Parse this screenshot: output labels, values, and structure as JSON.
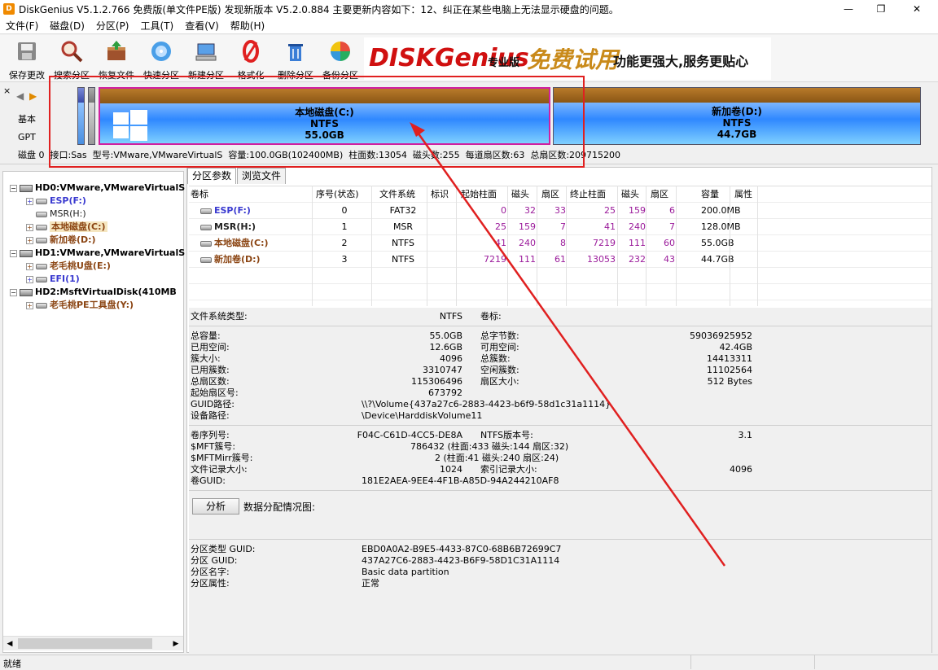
{
  "window": {
    "title": "DiskGenius V5.1.2.766 免费版(单文件PE版)   发现新版本 V5.2.0.884 主要更新内容如下：12、纠正在某些电脑上无法显示硬盘的问题。",
    "app_icon_text": "D",
    "minimize": "—",
    "maximize": "❐",
    "close": "✕"
  },
  "menu": [
    "文件(F)",
    "磁盘(D)",
    "分区(P)",
    "工具(T)",
    "查看(V)",
    "帮助(H)"
  ],
  "toolbar": [
    {
      "label": "保存更改",
      "icon": "save-icon",
      "color": "#777777"
    },
    {
      "label": "搜索分区",
      "icon": "magnifier-icon",
      "color": "#c0392b"
    },
    {
      "label": "恢复文件",
      "icon": "recover-box-icon",
      "color": "#a0522d"
    },
    {
      "label": "快速分区",
      "icon": "disc-icon",
      "color": "#2a7fd4"
    },
    {
      "label": "新建分区",
      "icon": "new-partition-icon",
      "color": "#4a90d9"
    },
    {
      "label": "格式化",
      "icon": "format-icon",
      "color": "#e02020"
    },
    {
      "label": "删除分区",
      "icon": "trash-icon",
      "color": "#2b6cc4"
    },
    {
      "label": "备份分区",
      "icon": "backup-pie-icon",
      "color": "#27ae60"
    }
  ],
  "banner": {
    "logo": "DISKGenius",
    "edition": "专业版",
    "slogan1": "免费试用",
    "slogan2": "功能更强大,服务更贴心"
  },
  "diskmap": {
    "left_labels": [
      "基本",
      "GPT"
    ],
    "nav_left": "◀",
    "nav_right": "▶",
    "close_x": "×",
    "partitions": [
      {
        "name": "本地磁盘(C:)",
        "fs": "NTFS",
        "size": "55.0GB"
      },
      {
        "name": "新加卷(D:)",
        "fs": "NTFS",
        "size": "44.7GB"
      }
    ],
    "info": "磁盘 0  接口:Sas  型号:VMware,VMwareVirtualS  容量:100.0GB(102400MB)  柱面数:13054  磁头数:255  每道扇区数:63  总扇区数:209715200"
  },
  "tree": [
    {
      "text": "HD0:VMware,VMwareVirtualS",
      "type": "disk",
      "color": "#000000"
    },
    {
      "text": "ESP(F:)",
      "type": "part",
      "color": "#3a3ad0"
    },
    {
      "text": "MSR(H:)",
      "type": "part",
      "color": "#222222"
    },
    {
      "text": "本地磁盘(C:)",
      "type": "part",
      "color": "#8b4513",
      "selected": true
    },
    {
      "text": "新加卷(D:)",
      "type": "part",
      "color": "#8b4513"
    },
    {
      "text": "HD1:VMware,VMwareVirtualS",
      "type": "disk",
      "color": "#000000"
    },
    {
      "text": "老毛桃U盘(E:)",
      "type": "part",
      "color": "#8b4513"
    },
    {
      "text": "EFI(1)",
      "type": "part",
      "color": "#3a3ad0"
    },
    {
      "text": "HD2:MsftVirtualDisk(410MB",
      "type": "disk",
      "color": "#000000"
    },
    {
      "text": "老毛桃PE工具盘(Y:)",
      "type": "part",
      "color": "#8b4513"
    }
  ],
  "tabs": [
    "分区参数",
    "浏览文件"
  ],
  "table": {
    "headers": [
      "卷标",
      "序号(状态)",
      "文件系统",
      "标识",
      "起始柱面",
      "磁头",
      "扇区",
      "终止柱面",
      "磁头",
      "扇区",
      "容量",
      "属性"
    ],
    "rows": [
      {
        "label": "ESP(F:)",
        "color": "#3a3ad0",
        "cells": [
          "0",
          "FAT32",
          "",
          "0",
          "32",
          "33",
          "25",
          "159",
          "6",
          "200.0MB",
          ""
        ]
      },
      {
        "label": "MSR(H:)",
        "color": "#222222",
        "cells": [
          "1",
          "MSR",
          "",
          "25",
          "159",
          "7",
          "41",
          "240",
          "7",
          "128.0MB",
          ""
        ]
      },
      {
        "label": "本地磁盘(C:)",
        "color": "#8b4513",
        "cells": [
          "2",
          "NTFS",
          "",
          "41",
          "240",
          "8",
          "7219",
          "111",
          "60",
          "55.0GB",
          ""
        ]
      },
      {
        "label": "新加卷(D:)",
        "color": "#8b4513",
        "cells": [
          "3",
          "NTFS",
          "",
          "7219",
          "111",
          "61",
          "13053",
          "232",
          "43",
          "44.7GB",
          ""
        ]
      }
    ]
  },
  "details": {
    "fs_type_label": "文件系统类型:",
    "fs_type": "NTFS",
    "volume_label_label": "卷标:",
    "left": [
      [
        "总容量:",
        "55.0GB"
      ],
      [
        "已用空间:",
        "12.6GB"
      ],
      [
        "簇大小:",
        "4096"
      ],
      [
        "已用簇数:",
        "3310747"
      ],
      [
        "总扇区数:",
        "115306496"
      ],
      [
        "起始扇区号:",
        "673792"
      ]
    ],
    "right": [
      [
        "总字节数:",
        "59036925952"
      ],
      [
        "可用空间:",
        "42.4GB"
      ],
      [
        "总簇数:",
        "14413311"
      ],
      [
        "空闲簇数:",
        "11102564"
      ],
      [
        "扇区大小:",
        "512 Bytes"
      ]
    ],
    "guid_path_label": "GUID路径:",
    "guid_path": "\\\\?\\Volume{437a27c6-2883-4423-b6f9-58d1c31a1114}",
    "device_path_label": "设备路径:",
    "device_path": "\\Device\\HarddiskVolume11",
    "serial_label": "卷序列号:",
    "serial": "F04C-C61D-4CC5-DE8A",
    "ntfs_ver_label": "NTFS版本号:",
    "ntfs_ver": "3.1",
    "mft_label": "$MFT簇号:",
    "mft": "786432 (柱面:433 磁头:144 扇区:32)",
    "mftmirr_label": "$MFTMirr簇号:",
    "mftmirr": "2 (柱面:41 磁头:240 扇区:24)",
    "rec_size_label": "文件记录大小:",
    "rec_size": "1024",
    "idx_size_label": "索引记录大小:",
    "idx_size": "4096",
    "vol_guid_label": "卷GUID:",
    "vol_guid": "181E2AEA-9EE4-4F1B-A85D-94A244210AF8",
    "analyze_button": "分析",
    "alloc_label": "数据分配情况图:",
    "ptype_guid_label": "分区类型 GUID:",
    "ptype_guid": "EBD0A0A2-B9E5-4433-87C0-68B6B72699C7",
    "p_guid_label": "分区 GUID:",
    "p_guid": "437A27C6-2883-4423-B6F9-58D1C31A1114",
    "p_name_label": "分区名字:",
    "p_name": "Basic data partition",
    "p_attr_label": "分区属性:",
    "p_attr": "正常"
  },
  "status": "就绪",
  "accent": "#e02020"
}
